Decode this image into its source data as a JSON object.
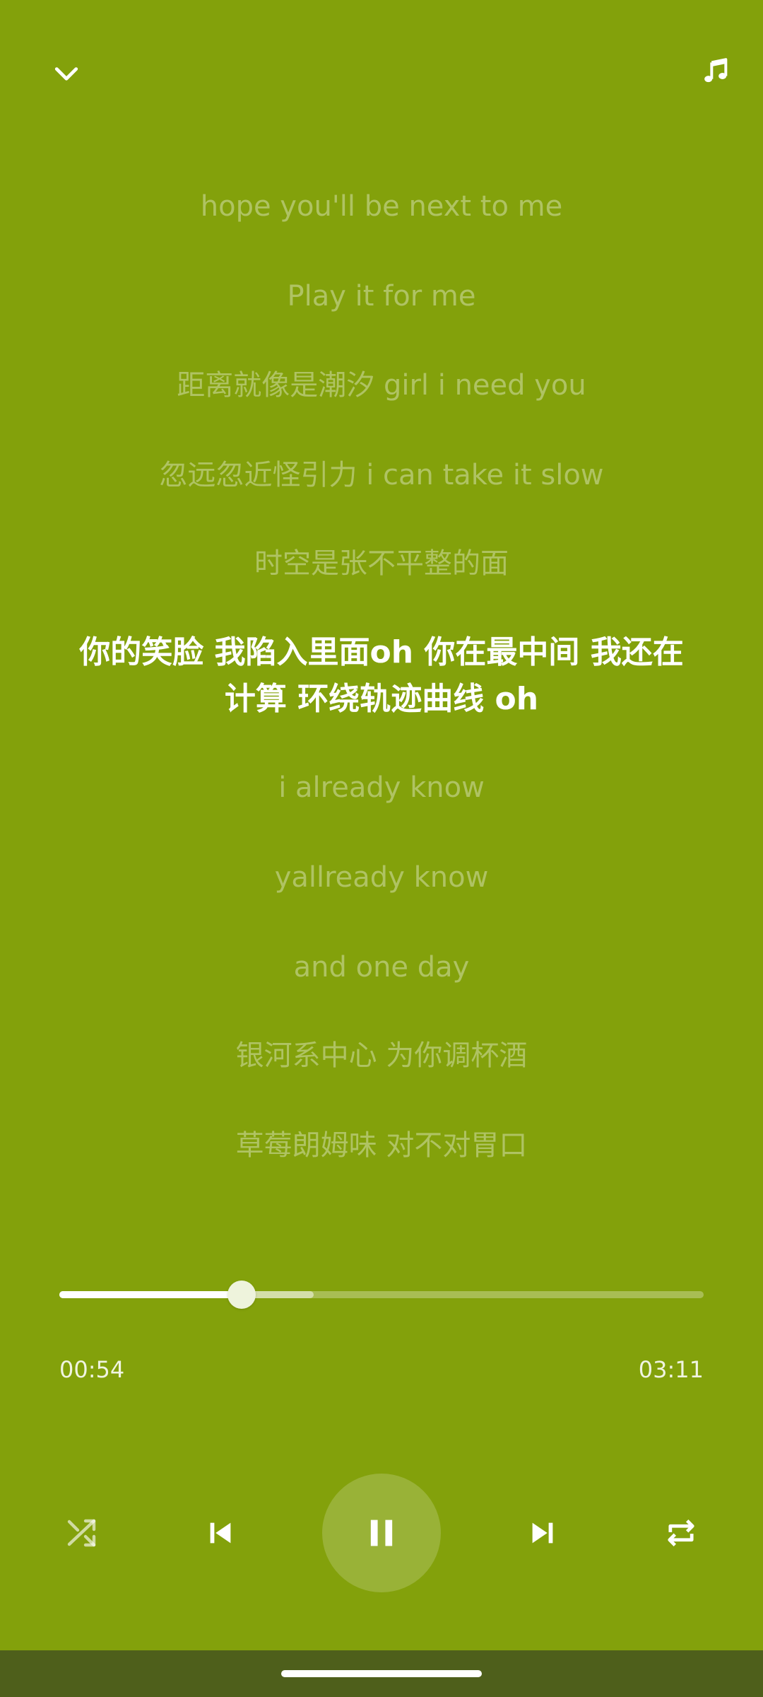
{
  "theme": {
    "background": "#83a10b",
    "nav_bar": "#4e5f1b",
    "lyric_dim": "rgba(255,255,255,0.36)",
    "lyric_active": "#ffffff"
  },
  "topbar": {
    "collapse_icon": "chevron-down-icon",
    "music_icon": "music-note-icon"
  },
  "lyrics": {
    "before": [
      "hope you'll be next to me",
      "Play it for me",
      "距离就像是潮汐 girl i need you",
      "忽远忽近怪引力 i can take it slow",
      "时空是张不平整的面"
    ],
    "current": "你的笑脸 我陷入里面oh 你在最中间 我还在计算 环绕轨迹曲线 oh",
    "after": [
      "i already know",
      "yallready know",
      "and one day",
      "银河系中心 为你调杯酒",
      "草莓朗姆味 对不对胃口"
    ]
  },
  "player": {
    "elapsed": "00:54",
    "total": "03:11",
    "progress_fraction": 0.2827,
    "buffered_fraction": 0.3947,
    "is_playing": true,
    "controls": {
      "shuffle_icon": "shuffle-icon",
      "previous_icon": "skip-previous-icon",
      "play_pause_icon": "pause-icon",
      "next_icon": "skip-next-icon",
      "repeat_icon": "repeat-icon"
    }
  }
}
